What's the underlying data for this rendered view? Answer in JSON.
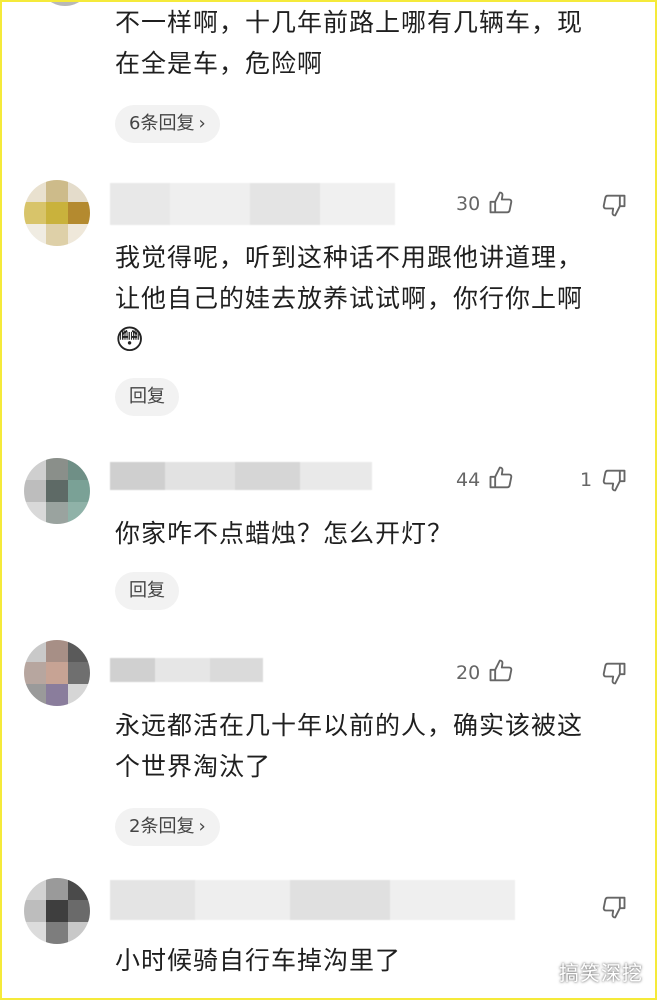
{
  "comments": [
    {
      "text": "不一样啊，十几年前路上哪有几辆车，现\n在全是车，危险啊",
      "reply_label": "6条回复",
      "chevron": "›"
    },
    {
      "like_count": "30",
      "dislike_count": "",
      "text": "我觉得呢，听到这种话不用跟他讲道理，\n让他自己的娃去放养试试啊，你行你上啊",
      "emoji": "😳",
      "reply_label": "回复"
    },
    {
      "like_count": "44",
      "dislike_count": "1",
      "text": "你家咋不点蜡烛？怎么开灯？",
      "reply_label": "回复"
    },
    {
      "like_count": "20",
      "dislike_count": "",
      "text": "永远都活在几十年以前的人，确实该被这\n个世界淘汰了",
      "reply_label": "2条回复",
      "chevron": "›"
    },
    {
      "text": "小时候骑自行车掉沟里了"
    }
  ],
  "watermark": "搞笑深挖",
  "icons": {
    "like": "thumbs-up-icon",
    "dislike": "thumbs-down-icon"
  },
  "colors": {
    "frame": "#f5ea3a",
    "text": "#1f1f1f",
    "pill_bg": "#f2f2f2",
    "meta": "#666666"
  }
}
